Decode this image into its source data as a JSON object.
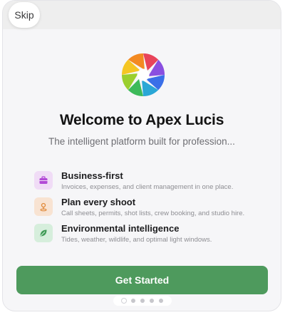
{
  "skip_label": "Skip",
  "title": "Welcome to Apex Lucis",
  "subtitle": "The intelligent platform built for profession...",
  "features": [
    {
      "title": "Business-first",
      "description": "Invoices, expenses, and client management in one place.",
      "icon": "briefcase-icon",
      "icon_color": "#b24ad6",
      "icon_bg": "#f0dcf6"
    },
    {
      "title": "Plan every shoot",
      "description": "Call sheets, permits, shot lists, crew booking, and studio hire.",
      "icon": "location-pin-icon",
      "icon_color": "#e08a3a",
      "icon_bg": "#f8e3d2"
    },
    {
      "title": "Environmental intelligence",
      "description": "Tides, weather, wildlife, and optimal light windows.",
      "icon": "leaf-icon",
      "icon_color": "#3f9a56",
      "icon_bg": "#d6eedc"
    }
  ],
  "cta_label": "Get Started",
  "pagination": {
    "total": 5,
    "current": 1
  },
  "colors": {
    "accent": "#4e9a5d"
  }
}
